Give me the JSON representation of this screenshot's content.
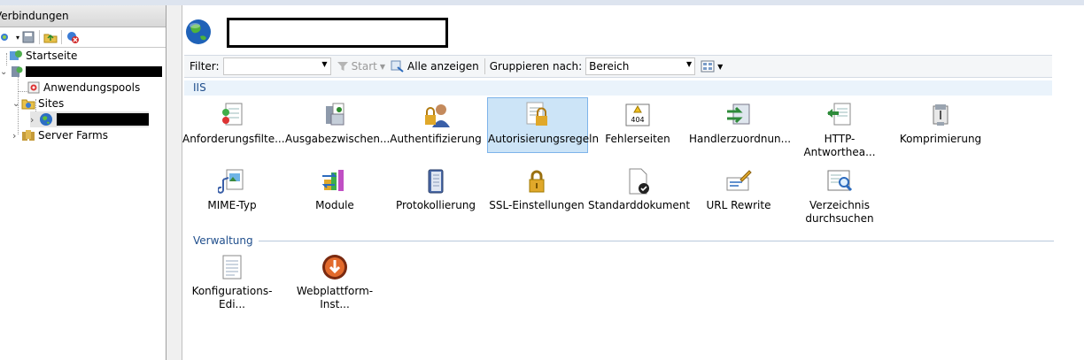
{
  "connections_panel": {
    "title": "Verbindungen",
    "tree": [
      {
        "label": "Startseite"
      },
      {
        "label": ""
      },
      {
        "label": "Anwendungspools"
      },
      {
        "label": "Sites"
      },
      {
        "label": ""
      },
      {
        "label": "Server Farms"
      }
    ]
  },
  "filter_bar": {
    "filter_label": "Filter:",
    "filter_value": "",
    "start_label": "Start",
    "show_all_label": "Alle anzeigen",
    "group_by_label": "Gruppieren nach:",
    "group_by_value": "Bereich"
  },
  "groups": [
    {
      "name": "IIS",
      "features": [
        {
          "label": "Anforderungsfilte...",
          "icon": "request-filtering-icon"
        },
        {
          "label": "Ausgabezwischen...",
          "icon": "output-caching-icon"
        },
        {
          "label": "Authentifizierung",
          "icon": "authentication-icon"
        },
        {
          "label": "Autorisierungsregeln",
          "icon": "authorization-rules-icon",
          "selected": true
        },
        {
          "label": "Fehlerseiten",
          "icon": "error-pages-icon",
          "badge": "404"
        },
        {
          "label": "Handlerzuordnun...",
          "icon": "handler-mappings-icon"
        },
        {
          "label": "HTTP-Antworthea...",
          "icon": "http-response-headers-icon"
        },
        {
          "label": "Komprimierung",
          "icon": "compression-icon"
        },
        {
          "label": "MIME-Typ",
          "icon": "mime-types-icon"
        },
        {
          "label": "Module",
          "icon": "modules-icon"
        },
        {
          "label": "Protokollierung",
          "icon": "logging-icon"
        },
        {
          "label": "SSL-Einstellungen",
          "icon": "ssl-settings-icon"
        },
        {
          "label": "Standarddokument",
          "icon": "default-document-icon"
        },
        {
          "label": "URL Rewrite",
          "icon": "url-rewrite-icon"
        },
        {
          "label": "Verzeichnis",
          "label2": "durchsuchen",
          "icon": "directory-browsing-icon"
        }
      ]
    },
    {
      "name": "Verwaltung",
      "features": [
        {
          "label": "Konfigurations-Edi...",
          "icon": "configuration-editor-icon"
        },
        {
          "label": "Webplattform-Inst...",
          "icon": "web-platform-installer-icon"
        }
      ]
    }
  ],
  "colors": {
    "group_header": "#1f4e8c",
    "selection": "#cce4f7",
    "selection_border": "#7eb4ea"
  }
}
